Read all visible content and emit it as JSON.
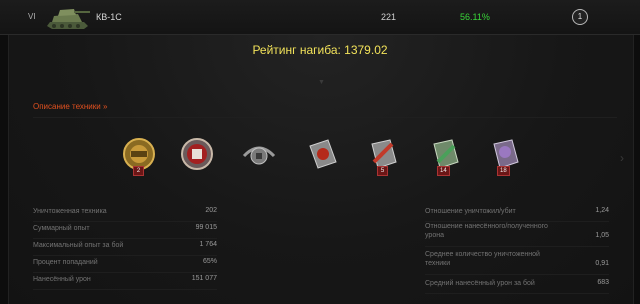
{
  "vehicle": {
    "tier": "VI",
    "name": "КВ-1С",
    "battles": "221",
    "winrate": "56.11%",
    "mastery_badge": "1",
    "icon": "heavy-tank-icon"
  },
  "rating": {
    "text": "Рейтинг нагиба: 1379.02"
  },
  "description_link": "Описание техники »",
  "achievements": [
    {
      "name": "top-gun-medal-icon",
      "count": "2"
    },
    {
      "name": "steel-wall-medal-icon",
      "count": ""
    },
    {
      "name": "mastery-medal-icon",
      "count": ""
    },
    {
      "name": "cards-medal-icon",
      "count": ""
    },
    {
      "name": "sniper-medal-icon",
      "count": "5"
    },
    {
      "name": "invader-medal-icon",
      "count": "14"
    },
    {
      "name": "defender-medal-icon",
      "count": "18"
    }
  ],
  "stats_left": [
    {
      "label": "Уничтоженная техника",
      "value": "202"
    },
    {
      "label": "Суммарный опыт",
      "value": "99 015"
    },
    {
      "label": "Максимальный опыт за бой",
      "value": "1 764"
    },
    {
      "label": "Процент попаданий",
      "value": "65%"
    },
    {
      "label": "Нанесённый урон",
      "value": "151 077"
    }
  ],
  "stats_right": [
    {
      "label": "Отношение уничтожил/убит",
      "value": "1,24"
    },
    {
      "label": "Отношение нанесённого/полученного урона",
      "value": "1,05"
    },
    {
      "label": "Среднее количество уничтоженной техники",
      "value": "0,91"
    },
    {
      "label": "Средний нанесённый урон за бой",
      "value": "683"
    }
  ],
  "colors": {
    "rating": "#f2e25a",
    "winrate": "#39d639",
    "link": "#e0501f",
    "badge_bg": "#6b1616"
  }
}
